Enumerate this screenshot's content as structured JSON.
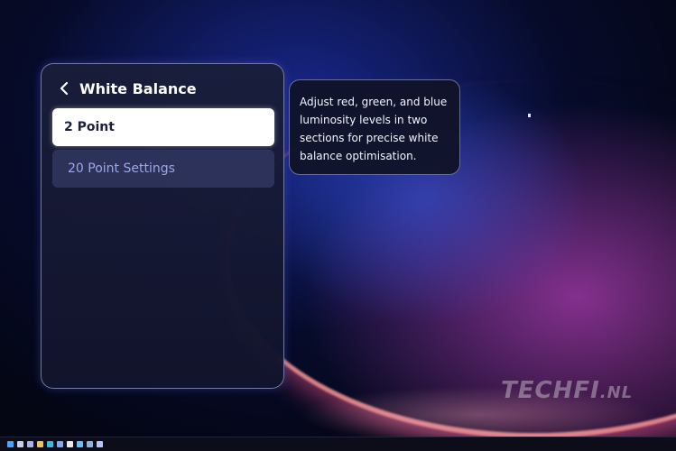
{
  "menu": {
    "title": "White Balance",
    "items": [
      {
        "label": "2 Point",
        "selected": true
      },
      {
        "label": "20 Point Settings",
        "selected": false
      }
    ]
  },
  "tooltip": {
    "line1": "Adjust red, green, and blue",
    "line2": "luminosity levels in two",
    "line3": "sections for precise white",
    "line4": "balance optimisation."
  },
  "watermark": {
    "main": "TECHFI",
    "suffix": ".NL"
  },
  "taskbar": {
    "icons": [
      {
        "name": "start-icon",
        "color": "#4aa3ff"
      },
      {
        "name": "search-icon",
        "color": "#c8cfe8"
      },
      {
        "name": "task-view-icon",
        "color": "#a7b5e0"
      },
      {
        "name": "file-explorer-icon",
        "color": "#f2c14e"
      },
      {
        "name": "edge-icon",
        "color": "#3fb5d8"
      },
      {
        "name": "store-icon",
        "color": "#7aa8ff"
      },
      {
        "name": "chrome-icon",
        "color": "#e9e9e9"
      },
      {
        "name": "app-icon",
        "color": "#5fc1ff"
      },
      {
        "name": "steam-icon",
        "color": "#8fb3d9"
      },
      {
        "name": "settings-icon",
        "color": "#b8c6ff"
      }
    ]
  },
  "colors": {
    "panel_border": "#bec8ff",
    "selected_item_bg": "#ffffff",
    "selected_item_text": "#1b2040",
    "normal_item_text": "#9aa8e8"
  }
}
